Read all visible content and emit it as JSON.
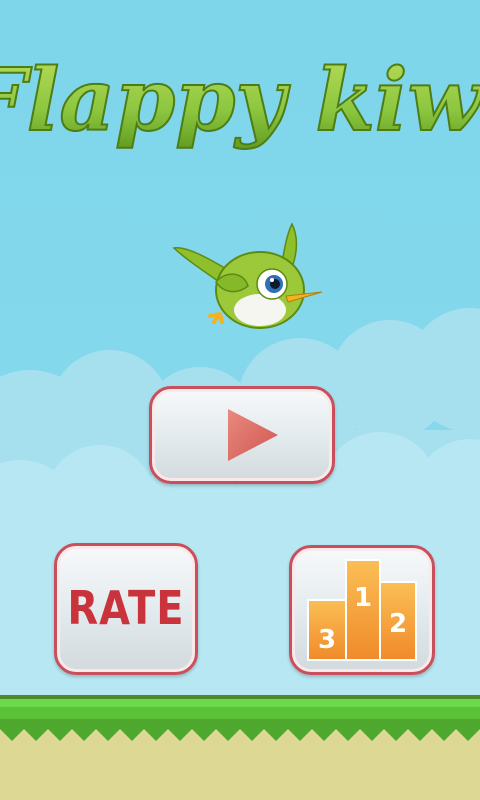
{
  "game": {
    "title": "Flappy kiwi"
  },
  "menu": {
    "play_icon": "play-triangle-icon",
    "rate_label": "RATE",
    "leaderboard_icon": "podium-icon",
    "podium_places": [
      "1",
      "2",
      "3"
    ]
  },
  "colors": {
    "sky": "#7dd6ea",
    "title_green": "#8cc63f",
    "button_border": "#c8505c",
    "play_triangle": "#e0746c",
    "rate_text": "#c9343c",
    "podium_orange": "#f7a43a",
    "grass": "#5fc93a"
  }
}
